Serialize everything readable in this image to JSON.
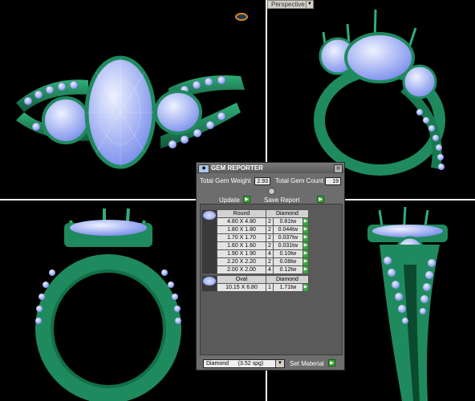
{
  "viewport": {
    "projection": "Perspective",
    "dropdown_icon": "chevron-down-icon"
  },
  "panel": {
    "title": "GEM REPORTER",
    "total_weight_label": "Total Gem Weight",
    "total_weight_value": "2.93",
    "total_count_label": "Total Gem Count",
    "total_count_value": "19",
    "update_label": "Update",
    "save_label": "Save Report",
    "groups": [
      {
        "shape": "Round",
        "material": "Diamond",
        "rows": [
          {
            "size": "4.80 X 4.80",
            "count": "2",
            "weight": "0.81tw"
          },
          {
            "size": "1.80 X 1.80",
            "count": "2",
            "weight": "0.044tw"
          },
          {
            "size": "1.70 X 1.70",
            "count": "2",
            "weight": "0.037tw"
          },
          {
            "size": "1.60 X 1.60",
            "count": "2",
            "weight": "0.031tw"
          },
          {
            "size": "1.90 X 1.90",
            "count": "4",
            "weight": "0.10tw"
          },
          {
            "size": "2.20 X 2.20",
            "count": "2",
            "weight": "0.08tw"
          },
          {
            "size": "2.00 X 2.00",
            "count": "4",
            "weight": "0.12tw"
          }
        ]
      },
      {
        "shape": "Oval",
        "material": "Diamond",
        "rows": [
          {
            "size": "10.15 X 6.80",
            "count": "1",
            "weight": "1.71tw"
          }
        ]
      }
    ],
    "material_select": "Diamond      (3.52 spg)",
    "set_material_label": "Set Material"
  },
  "colors": {
    "ring_metal": "#1f8a5e",
    "gem": "#a8b8f5",
    "panel_bg": "#6d6d6d",
    "action_green": "#3aa73a"
  }
}
